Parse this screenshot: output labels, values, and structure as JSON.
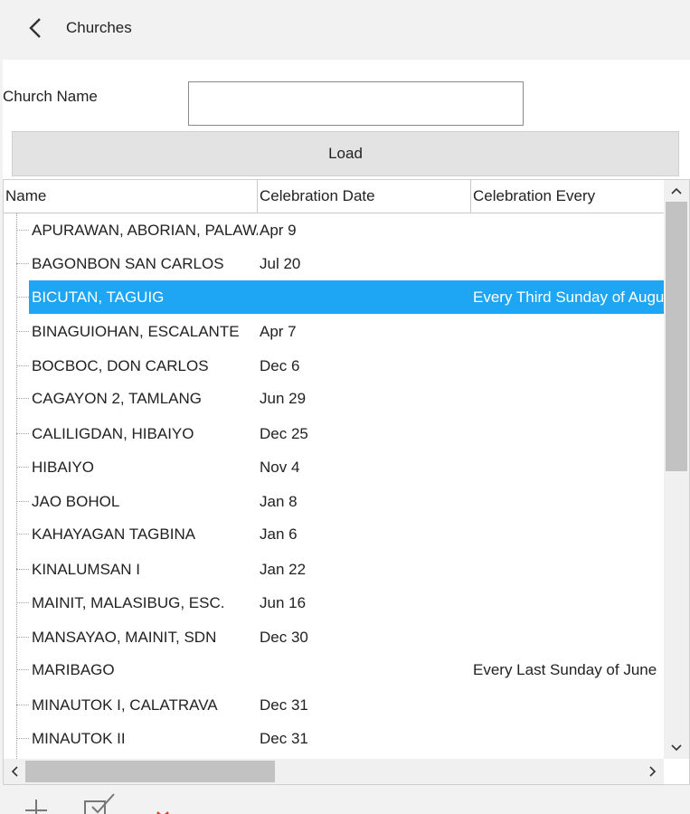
{
  "header": {
    "title": "Churches",
    "back_icon": "chevron-left-icon"
  },
  "form": {
    "name_label": "Church Name",
    "name_value": "",
    "load_label": "Load"
  },
  "grid": {
    "columns": [
      "Name",
      "Celebration Date",
      "Celebration Every"
    ],
    "selected_index": 2,
    "selected_color": "#1ea6f5",
    "rows": [
      {
        "name": "APURAWAN, ABORIAN, PALAWAN",
        "date": "Apr 9",
        "every": ""
      },
      {
        "name": "BAGONBON SAN CARLOS",
        "date": "Jul 20",
        "every": ""
      },
      {
        "name": "BICUTAN, TAGUIG",
        "date": "",
        "every": "Every Third Sunday of August"
      },
      {
        "name": "BINAGUIOHAN, ESCALANTE",
        "date": "Apr 7",
        "every": ""
      },
      {
        "name": "BOCBOC, DON CARLOS",
        "date": "Dec 6",
        "every": ""
      },
      {
        "name": "CAGAYON 2, TAMLANG",
        "date": "Jun 29",
        "every": ""
      },
      {
        "name": "CALILIGDAN, HIBAIYO",
        "date": "Dec 25",
        "every": ""
      },
      {
        "name": "HIBAIYO",
        "date": "Nov 4",
        "every": ""
      },
      {
        "name": "JAO BOHOL",
        "date": "Jan 8",
        "every": ""
      },
      {
        "name": "KAHAYAGAN TAGBINA",
        "date": "Jan 6",
        "every": ""
      },
      {
        "name": "KINALUMSAN I",
        "date": "Jan 22",
        "every": ""
      },
      {
        "name": "MAINIT, MALASIBUG, ESC.",
        "date": "Jun 16",
        "every": ""
      },
      {
        "name": "MANSAYAO, MAINIT, SDN",
        "date": "Dec 30",
        "every": ""
      },
      {
        "name": "MARIBAGO",
        "date": "",
        "every": "Every Last Sunday of June"
      },
      {
        "name": "MINAUTOK I, CALATRAVA",
        "date": "Dec 31",
        "every": ""
      },
      {
        "name": "MINAUTOK II",
        "date": "Dec 31",
        "every": ""
      }
    ]
  },
  "toolbar": {
    "icons": [
      "add-icon",
      "edit-icon",
      "delete-icon"
    ]
  }
}
